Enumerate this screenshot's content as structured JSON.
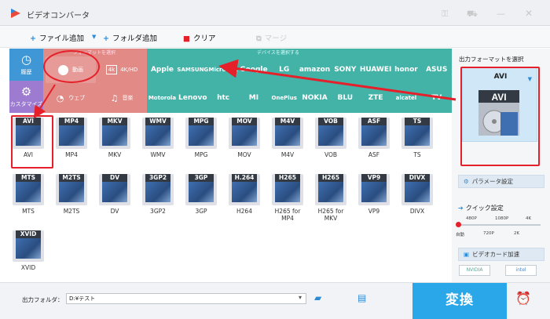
{
  "window": {
    "title": "ビデオコンバータ"
  },
  "toolbar": {
    "add_file": "ファイル追加",
    "add_folder": "フォルダ追加",
    "clear": "クリア",
    "merge": "マージ"
  },
  "sidebar": {
    "history": "履歴",
    "customize": "カスタマイズ"
  },
  "categories": {
    "header": "フォーマットを選択",
    "video": "動画",
    "uhd": "4K/HD",
    "web": "ウェブ",
    "music": "音楽"
  },
  "devices": {
    "header": "デバイスを選択する",
    "row1": [
      "Apple",
      "SAMSUNG",
      "Microsoft",
      "Google",
      "LG",
      "amazon",
      "SONY",
      "HUAWEI",
      "honor",
      "ASUS"
    ],
    "row2": [
      "Motorola",
      "Lenovo",
      "htc",
      "MI",
      "OnePlus",
      "NOKIA",
      "BLU",
      "ZTE",
      "alcatel",
      "TV"
    ]
  },
  "formats": {
    "row1": [
      {
        "badge": "AVI",
        "label": "AVI"
      },
      {
        "badge": "MP4",
        "label": "MP4"
      },
      {
        "badge": "MKV",
        "label": "MKV"
      },
      {
        "badge": "WMV",
        "label": "WMV"
      },
      {
        "badge": "MPG",
        "label": "MPG"
      },
      {
        "badge": "MOV",
        "label": "MOV"
      },
      {
        "badge": "M4V",
        "label": "M4V"
      },
      {
        "badge": "VOB",
        "label": "VOB"
      },
      {
        "badge": "ASF",
        "label": "ASF"
      },
      {
        "badge": "TS",
        "label": "TS"
      }
    ],
    "row2": [
      {
        "badge": "MTS",
        "label": "MTS"
      },
      {
        "badge": "M2TS",
        "label": "M2TS"
      },
      {
        "badge": "DV",
        "label": "DV"
      },
      {
        "badge": "3GP2",
        "label": "3GP2"
      },
      {
        "badge": "3GP",
        "label": "3GP"
      },
      {
        "badge": "H.264",
        "label": "H264"
      },
      {
        "badge": "H265",
        "label": "H265 for MP4"
      },
      {
        "badge": "H265",
        "label": "H265 for MKV"
      },
      {
        "badge": "VP9",
        "label": "VP9"
      },
      {
        "badge": "DIVX",
        "label": "DIVX"
      }
    ],
    "row3": [
      {
        "badge": "XVID",
        "label": "XVID"
      }
    ]
  },
  "right_panel": {
    "title": "出力フォーマットを選択",
    "selected": "AVI",
    "param_btn": "パラメータ設定",
    "quick_title": "クイック設定",
    "quality_top": [
      "480P",
      "1080P",
      "4K"
    ],
    "quality_bottom": [
      "自動",
      "720P",
      "2K"
    ],
    "gpu_btn": "ビデオカード加速",
    "gpu_vendors": [
      "NVIDIA",
      "intel"
    ]
  },
  "bottom": {
    "folder_label": "出力フォルダ：",
    "folder_value": "D:¥テスト",
    "convert": "変換"
  }
}
